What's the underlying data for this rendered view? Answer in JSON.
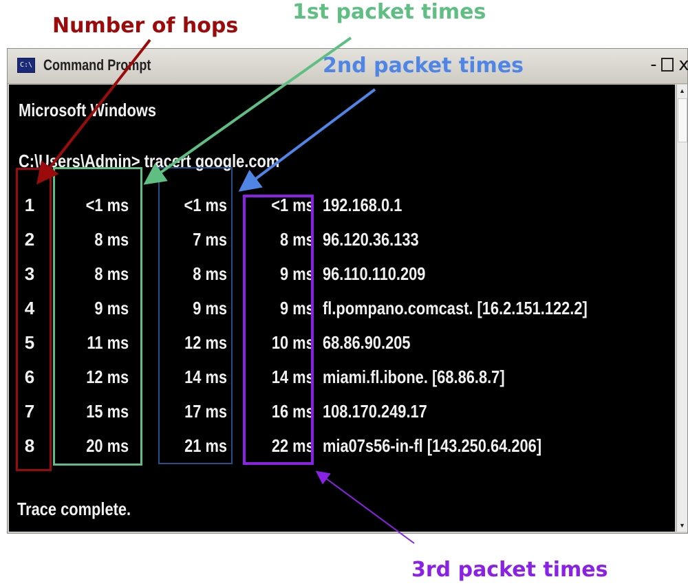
{
  "annotations": {
    "hops": {
      "label": "Number of hops",
      "color": "#9b0b0b"
    },
    "first": {
      "label": "1st packet times",
      "color": "#5fbf82"
    },
    "second": {
      "label": "2nd packet times",
      "color": "#4f86e6"
    },
    "third": {
      "label": "3rd packet times",
      "color": "#8a22e6"
    }
  },
  "window": {
    "title": "Command Prompt",
    "icon": "console-app-icon",
    "controls": {
      "minimize": "-",
      "maximize": "",
      "close": "x"
    }
  },
  "console": {
    "banner": "Microsoft Windows",
    "command": "C:\\Users\\Admin> tracert  google.com",
    "rows": [
      {
        "hop": "1",
        "t1": "<1  ms",
        "t2": "<1  ms",
        "t3": "<1  ms",
        "host": "192.168.0.1"
      },
      {
        "hop": "2",
        "t1": "8  ms",
        "t2": "7  ms",
        "t3": "8  ms",
        "host": "96.120.36.133"
      },
      {
        "hop": "3",
        "t1": "8  ms",
        "t2": "8  ms",
        "t3": "9  ms",
        "host": "96.110.110.209"
      },
      {
        "hop": "4",
        "t1": "9  ms",
        "t2": "9  ms",
        "t3": "9  ms",
        "host": "fl.pompano.comcast. [16.2.151.122.2]"
      },
      {
        "hop": "5",
        "t1": "11  ms",
        "t2": "12  ms",
        "t3": "10  ms",
        "host": "68.86.90.205"
      },
      {
        "hop": "6",
        "t1": "12  ms",
        "t2": "14  ms",
        "t3": "14  ms",
        "host": "miami.fl.ibone. [68.86.8.7]"
      },
      {
        "hop": "7",
        "t1": "15  ms",
        "t2": "17  ms",
        "t3": "16  ms",
        "host": "108.170.249.17"
      },
      {
        "hop": "8",
        "t1": "20  ms",
        "t2": "21  ms",
        "t3": "22  ms",
        "host": "mia07s56-in-fl [143.250.64.206]"
      }
    ],
    "footer": "Trace complete.",
    "colors": {
      "background": "#000000",
      "text": "#f0f0f0"
    }
  }
}
